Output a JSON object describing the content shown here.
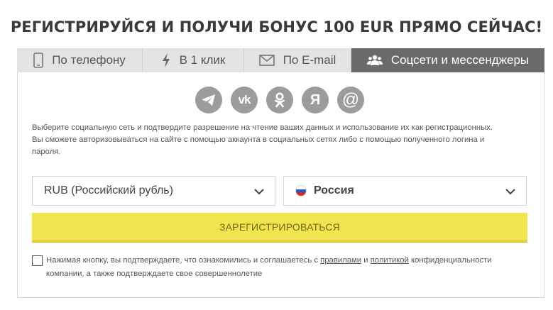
{
  "heading": "РЕГИСТРИРУЙСЯ И ПОЛУЧИ БОНУС 100 EUR ПРЯМО СЕЙЧАС!",
  "tabs": [
    {
      "label": "По телефону",
      "icon": "phone-icon",
      "active": false
    },
    {
      "label": "В 1 клик",
      "icon": "lightning-icon",
      "active": false
    },
    {
      "label": "По E-mail",
      "icon": "envelope-icon",
      "active": false
    },
    {
      "label": "Соцсети и мессенджеры",
      "icon": "users-icon",
      "active": true
    }
  ],
  "socials": [
    {
      "name": "telegram",
      "icon": "telegram-icon",
      "glyph": ""
    },
    {
      "name": "vk",
      "icon": "vk-icon",
      "glyph": "vk"
    },
    {
      "name": "odnoklassniki",
      "icon": "odnoklassniki-icon",
      "glyph": ""
    },
    {
      "name": "yandex",
      "icon": "yandex-icon",
      "glyph": "Я"
    },
    {
      "name": "mail",
      "icon": "at-icon",
      "glyph": "@"
    }
  ],
  "description": {
    "line1": "Выберите социальную сеть и подтвердите разрешение на чтение ваших данных и использование их как регистрационных.",
    "line2": "Вы сможете авторизовываться на сайте с помощью аккаунта в социальных сетях либо с помощью полученного логина и пароля."
  },
  "currency_select": {
    "value": "RUB (Российский рубль)"
  },
  "country_select": {
    "value": "Россия"
  },
  "register_button": "ЗАРЕГИСТРИРОВАТЬСЯ",
  "agreement": {
    "checked": false,
    "text_before": "Нажимая кнопку, вы подтверждаете, что ознакомились и соглашаетесь с ",
    "link_rules": "правилами",
    "text_and": " и ",
    "link_policy": "политикой",
    "text_after": " конфиденциальности компании, а также подтверждаете свое совершеннолетие"
  },
  "colors": {
    "tab_active_bg": "#6a6a6a",
    "tab_bg": "#e4e4e4",
    "social_icon_bg": "#9c9c9c",
    "register_button_bg": "#f0e54e",
    "flag_white": "#ffffff",
    "flag_blue": "#1c57c9",
    "flag_red": "#d52b1e"
  }
}
